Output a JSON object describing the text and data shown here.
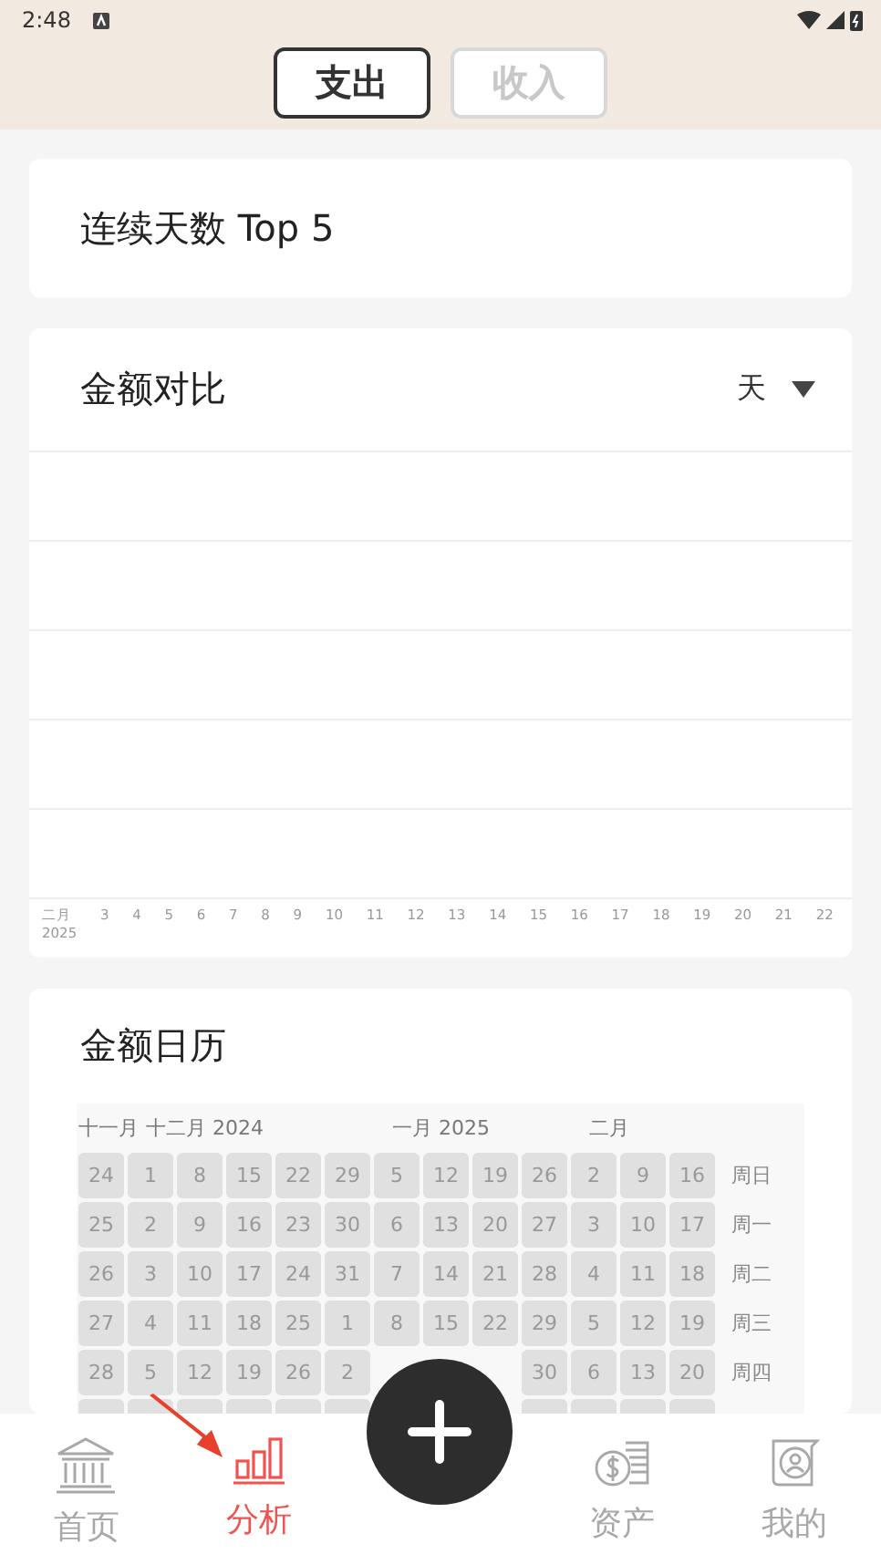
{
  "status_bar": {
    "time": "2:48"
  },
  "tabs": [
    {
      "label": "支出",
      "selected": true
    },
    {
      "label": "收入",
      "selected": false
    }
  ],
  "streak_card": {
    "title": "连续天数 Top 5"
  },
  "compare_card": {
    "title": "金额对比",
    "period": "天",
    "x_axis": [
      {
        "label": "二月",
        "year": "2025"
      },
      {
        "label": "3"
      },
      {
        "label": "4"
      },
      {
        "label": "5"
      },
      {
        "label": "6"
      },
      {
        "label": "7"
      },
      {
        "label": "8"
      },
      {
        "label": "9"
      },
      {
        "label": "10"
      },
      {
        "label": "11"
      },
      {
        "label": "12"
      },
      {
        "label": "13"
      },
      {
        "label": "14"
      },
      {
        "label": "15"
      },
      {
        "label": "16"
      },
      {
        "label": "17"
      },
      {
        "label": "18"
      },
      {
        "label": "19"
      },
      {
        "label": "20"
      },
      {
        "label": "21"
      },
      {
        "label": "22"
      }
    ]
  },
  "calendar_card": {
    "title": "金额日历",
    "weekdays": [
      "周日",
      "周一",
      "周二",
      "周三",
      "周四"
    ],
    "weeks": [
      {
        "month": "十一月",
        "days": [
          "24",
          "25",
          "26",
          "27",
          "28"
        ]
      },
      {
        "month": "十二月 2024",
        "days": [
          "1",
          "2",
          "3",
          "4",
          "5"
        ]
      },
      {
        "days": [
          "8",
          "9",
          "10",
          "11",
          "12"
        ]
      },
      {
        "days": [
          "15",
          "16",
          "17",
          "18",
          "19"
        ]
      },
      {
        "days": [
          "22",
          "23",
          "24",
          "25",
          "26"
        ]
      },
      {
        "days": [
          "29",
          "30",
          "31",
          "1",
          "2"
        ]
      },
      {
        "month": "一月 2025",
        "days": [
          "5",
          "6",
          "7",
          "8"
        ]
      },
      {
        "days": [
          "12",
          "13",
          "14",
          "15"
        ]
      },
      {
        "days": [
          "19",
          "20",
          "21",
          "22"
        ]
      },
      {
        "days": [
          "26",
          "27",
          "28",
          "29",
          "30"
        ]
      },
      {
        "month": "二月",
        "days": [
          "2",
          "3",
          "4",
          "5",
          "6"
        ]
      },
      {
        "days": [
          "9",
          "10",
          "11",
          "12",
          "13"
        ]
      },
      {
        "days": [
          "16",
          "17",
          "18",
          "19",
          "20"
        ]
      }
    ]
  },
  "bottom_nav": [
    {
      "kind": "home",
      "label": "首页",
      "selected": false
    },
    {
      "kind": "analysis",
      "label": "分析",
      "selected": true
    },
    {
      "kind": "add"
    },
    {
      "kind": "assets",
      "label": "资产",
      "selected": false
    },
    {
      "kind": "profile",
      "label": "我的",
      "selected": false
    }
  ]
}
